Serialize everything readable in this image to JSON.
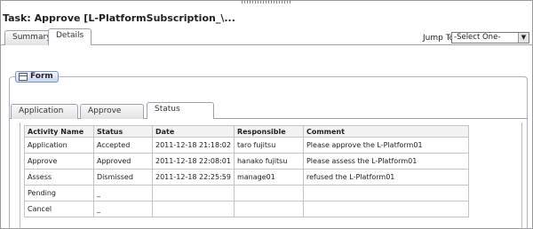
{
  "task_title": "Task: Approve [L-PlatformSubscription_\\...",
  "top_tabs": [
    "Summary",
    "Details"
  ],
  "jump_to": {
    "label": "Jump To",
    "selected": "-Select One-"
  },
  "form": {
    "legend": "Form",
    "tabs": [
      "Application",
      "Approve",
      "Status"
    ],
    "columns": [
      "Activity Name",
      "Status",
      "Date",
      "Responsible",
      "Comment"
    ],
    "rows": [
      [
        "Application",
        "Accepted",
        "2011-12-18 21:18:02",
        "taro fujitsu",
        "Please approve the L-Platform01"
      ],
      [
        "Approve",
        "Approved",
        "2011-12-18 22:08:01",
        "hanako fujitsu",
        "Please assess the L-Platform01"
      ],
      [
        "Assess",
        "Dismissed",
        "2011-12-18 22:25:59",
        "manage01",
        "refused the L-Platform01"
      ],
      [
        "Pending",
        "_",
        "",
        "",
        ""
      ],
      [
        "Cancel",
        "_",
        "",
        "",
        ""
      ]
    ]
  }
}
